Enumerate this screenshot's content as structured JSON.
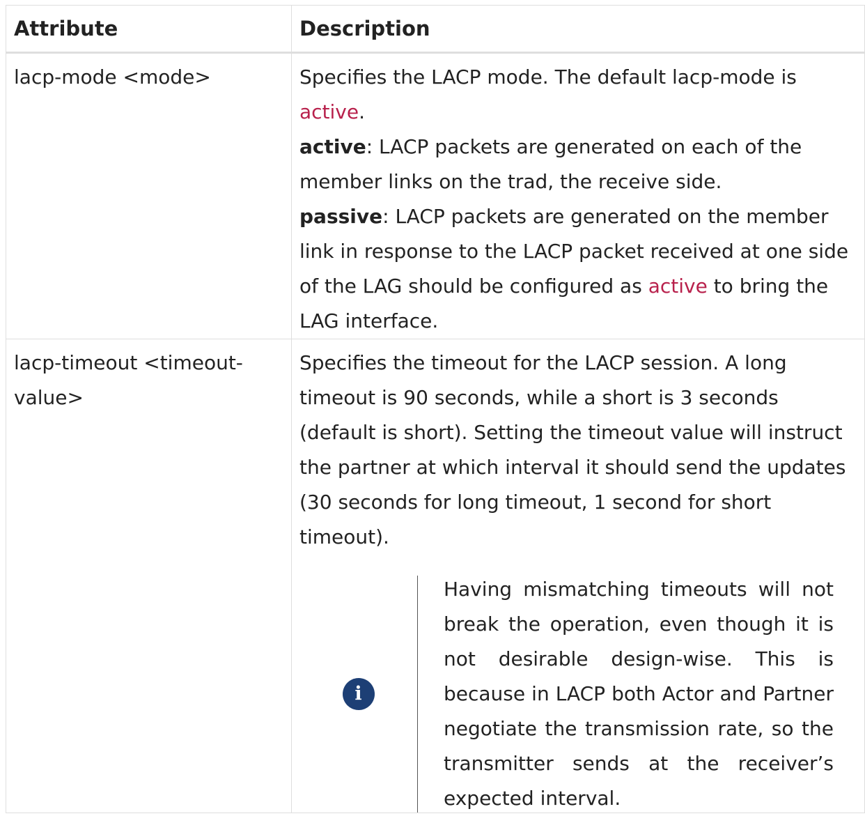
{
  "table": {
    "headers": {
      "attribute": "Attribute",
      "description": "Description"
    },
    "rows": [
      {
        "attribute": "lacp-mode <mode>",
        "description": {
          "intro_prefix": "Specifies the LACP mode. The default lacp-mode is ",
          "intro_keyword": "active",
          "intro_suffix": ".",
          "active_term": "active",
          "active_text": ": LACP packets are generated on each of the member links on the trad, the receive side.",
          "passive_term": "passive",
          "passive_prefix": ": LACP packets are generated on the member link in response to the LACP packet received at one side of the LAG should be configured as ",
          "passive_keyword": "active",
          "passive_suffix": " to bring the LAG interface."
        }
      },
      {
        "attribute": "lacp-timeout <timeout-value>",
        "description": {
          "text": "Specifies the timeout for the LACP session. A long timeout is 90 seconds, while a short is 3 seconds (default is short). Setting the timeout value will instruct the partner at which interval it should send the updates (30 seconds for long timeout, 1 second for short timeout).",
          "note_icon": "info-icon",
          "note_text": "Having mismatching timeouts will not break the operation, even though it is not desirable design-wise. This is because in LACP both Actor and Partner negotiate the transmission rate, so the transmitter sends at the receiver’s expected interval."
        }
      }
    ]
  },
  "colors": {
    "keyword": "#b8214c",
    "info_icon_bg": "#1d3f75",
    "border": "#dedede"
  }
}
